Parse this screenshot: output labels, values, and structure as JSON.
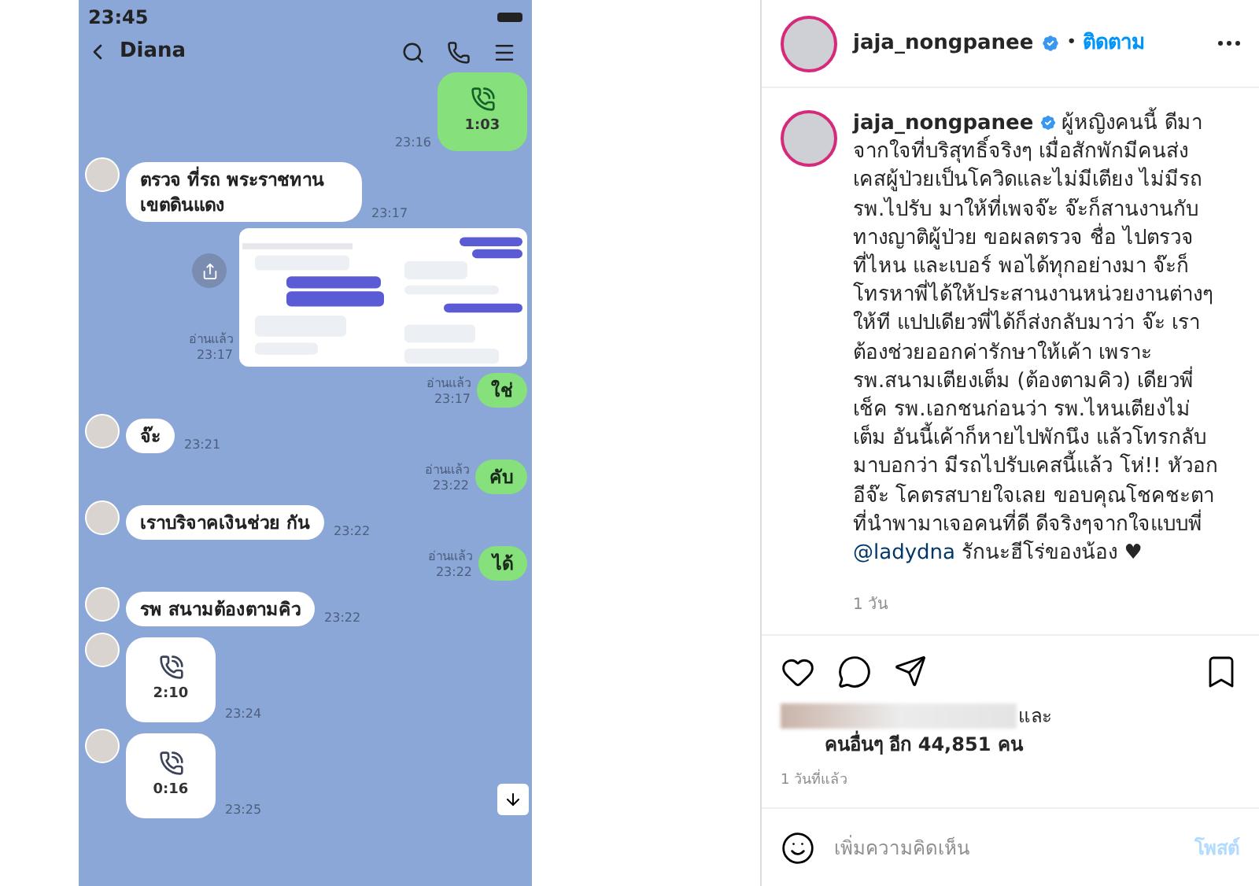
{
  "phone": {
    "status_time": "23:45",
    "chat_title": "Diana",
    "messages": [
      {
        "kind": "sent_call",
        "duration": "1:03",
        "time": "23:16"
      },
      {
        "kind": "received_text",
        "text": "ตรวจ ที่รถ พระราชทาน เขตดินแดง",
        "time": "23:17"
      },
      {
        "kind": "sent_image",
        "read": "อ่านแล้ว",
        "time": "23:17"
      },
      {
        "kind": "sent_text",
        "text": "ใช่",
        "read": "อ่านแล้ว",
        "time": "23:17"
      },
      {
        "kind": "received_text",
        "text": "จ๊ะ",
        "time": "23:21"
      },
      {
        "kind": "sent_text",
        "text": "คับ",
        "read": "อ่านแล้ว",
        "time": "23:22"
      },
      {
        "kind": "received_text",
        "text": "เราบริจาคเงินช่วย กัน",
        "time": "23:22"
      },
      {
        "kind": "sent_text",
        "text": "ได้",
        "read": "อ่านแล้ว",
        "time": "23:22"
      },
      {
        "kind": "received_text",
        "text": "รพ สนามต้องตามคิว",
        "time": "23:22"
      },
      {
        "kind": "received_call",
        "duration": "2:10",
        "time": "23:24"
      },
      {
        "kind": "received_call",
        "duration": "0:16",
        "time": "23:25"
      }
    ]
  },
  "post": {
    "author": "jaja_nongpanee",
    "verified": true,
    "follow_separator": "•",
    "follow": "ติดตาม",
    "caption": {
      "author": "jaja_nongpanee",
      "verified": true,
      "text": "ผู้หญิงคนนี้ ดีมาจากใจที่บริสุทธิ์จริงๆ เมื่อสักพักมีคนส่งเคสผู้ป่วยเป็นโควิดและไม่มีเตียง ไม่มีรถ รพ.ไปรับ มาให้ที่เพจจ๊ะ จ๊ะก็สานงานกับทางญาติผู้ป่วย ขอผลตรวจ ชื่อ ไปตรวจที่ไหน และเบอร์ พอได้ทุกอย่างมา จ๊ะก็โทรหาพี่ได้ให้ประสานงานหน่วยงานต่างๆให้ที แปปเดียวพี่ได้ก็ส่งกลับมาว่า จ๊ะ เราต้องช่วยออกค่ารักษาให้เค้า เพราะ รพ.สนามเตียงเต็ม (ต้องตามคิว) เดียวพี่เช็ค รพ.เอกชนก่อนว่า รพ.ไหนเตียงไม่เต็ม อันนี้เค้าก็หายไปพักนึง แล้วโทรกลับมาบอกว่า มีรถไปรับเคสนี้แล้ว โห่!! หัวอกอีจ๊ะ โคตรสบายใจเลย ขอบคุณโชคชะตาที่นำพามาเจอคนที่ดี ดีจริงๆจากใจแบบพี่",
      "mention": "@ladydna",
      "text_after": "รักนะฮีโร่ของน้อง ♥",
      "age": "1 วัน"
    },
    "likes": {
      "and": "และ",
      "others": "คนอื่นๆ อีก 44,851 คน"
    },
    "date": "1 วันที่แล้ว",
    "comment": {
      "placeholder": "เพิ่มความคิดเห็น",
      "post_button": "โพสต์",
      "post_disabled": true
    }
  }
}
